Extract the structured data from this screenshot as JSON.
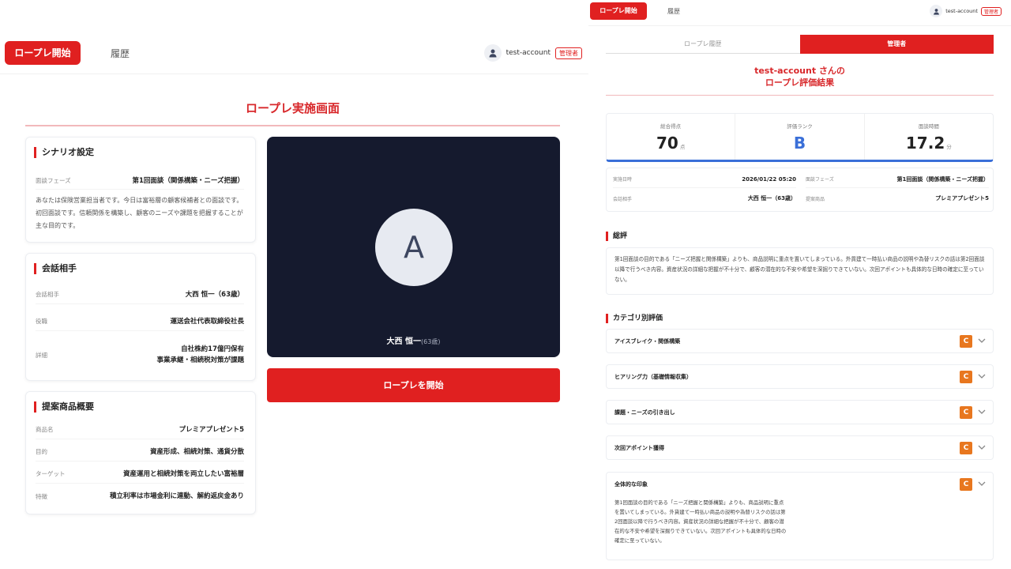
{
  "left": {
    "nav": {
      "start_label": "ロープレ開始",
      "history_label": "履歴",
      "username": "test-account",
      "admin_badge": "管理者"
    },
    "page_title": "ロープレ実施画面",
    "scenario": {
      "heading": "シナリオ設定",
      "phase_label": "面談フェーズ",
      "phase_value": "第1回面談（関係構築・ニーズ把握）",
      "description": "あなたは保険営業担当者です。今日は富裕層の顧客候補者との面談です。初回面談です。信頼関係を構築し、顧客のニーズや課題を把握することが主な目的です。"
    },
    "partner": {
      "heading": "会話相手",
      "rows": [
        {
          "label": "会話相手",
          "value": "大西 恒一（63歳）"
        },
        {
          "label": "役職",
          "value": "運送会社代表取締役社長"
        },
        {
          "label": "詳細",
          "value": "自社株約17億円保有\n事業承継・相続税対策が課題"
        }
      ]
    },
    "product": {
      "heading": "提案商品概要",
      "rows": [
        {
          "label": "商品名",
          "value": "プレミアプレゼント5"
        },
        {
          "label": "目的",
          "value": "資産形成、相続対策、通貨分散"
        },
        {
          "label": "ターゲット",
          "value": "資産運用と相続対策を両立したい富裕層"
        },
        {
          "label": "特徴",
          "value": "積立利率は市場金利に連動、解約返戻金あり"
        }
      ]
    },
    "video": {
      "avatar_letter": "A",
      "name": "大西 恒一",
      "age": "(63歳)"
    },
    "start_button": "ロープレを開始"
  },
  "right": {
    "nav": {
      "start_label": "ロープレ開始",
      "history_label": "履歴",
      "username": "test-account",
      "admin_badge": "管理者"
    },
    "tabs": [
      {
        "label": "ロープレ履歴",
        "active": false
      },
      {
        "label": "管理者",
        "active": true
      }
    ],
    "title_line1": "test-account さんの",
    "title_line2": "ロープレ評価結果",
    "scores": [
      {
        "label": "総合得点",
        "value": "70",
        "unit": "点"
      },
      {
        "label": "評価ランク",
        "value": "B",
        "unit": ""
      },
      {
        "label": "面談時間",
        "value": "17.2",
        "unit": "分"
      }
    ],
    "meta": [
      {
        "label": "実施日時",
        "value": "2026/01/22 05:20"
      },
      {
        "label": "面談フェーズ",
        "value": "第1回面談（関係構築・ニーズ把握）"
      },
      {
        "label": "会話相手",
        "value": "大西 恒一（63歳）"
      },
      {
        "label": "提案商品",
        "value": "プレミアプレゼント5"
      }
    ],
    "summary_heading": "総評",
    "summary_text": "第1回面談の目的である「ニーズ把握と関係構築」よりも、商品説明に重点を置いてしまっている。外貨建て一時払い商品の説明や為替リスクの話は第2回面談以降で行うべき内容。資産状況の詳細な把握が不十分で、顧客の潜在的な不安や希望を深掘りできていない。次回アポイントも具体的な日時の確定に至っていない。",
    "category_heading": "カテゴリ別評価",
    "categories": [
      {
        "label": "アイスブレイク・関係構築",
        "grade": "C"
      },
      {
        "label": "ヒアリング力（基礎情報収集）",
        "grade": "C"
      },
      {
        "label": "課題・ニーズの引き出し",
        "grade": "C"
      },
      {
        "label": "次回アポイント獲得",
        "grade": "C"
      },
      {
        "label": "全体的な印象",
        "grade": "C"
      }
    ],
    "overall_text": "第1回面談の目的である「ニーズ把握と関係構築」よりも、商品説明に重点を置いてしまっている。外貨建て一時払い商品の説明や為替リスクの話は第2回面談以降で行うべき内容。資産状況の詳細な把握が不十分で、顧客の潜在的な不安や希望を深掘りできていない。次回アポイントも具体的な日時の確定に至っていない。",
    "colors": {
      "accent": "#e02020",
      "rank": "#3a6fd8",
      "grade": "#e8771f"
    }
  }
}
